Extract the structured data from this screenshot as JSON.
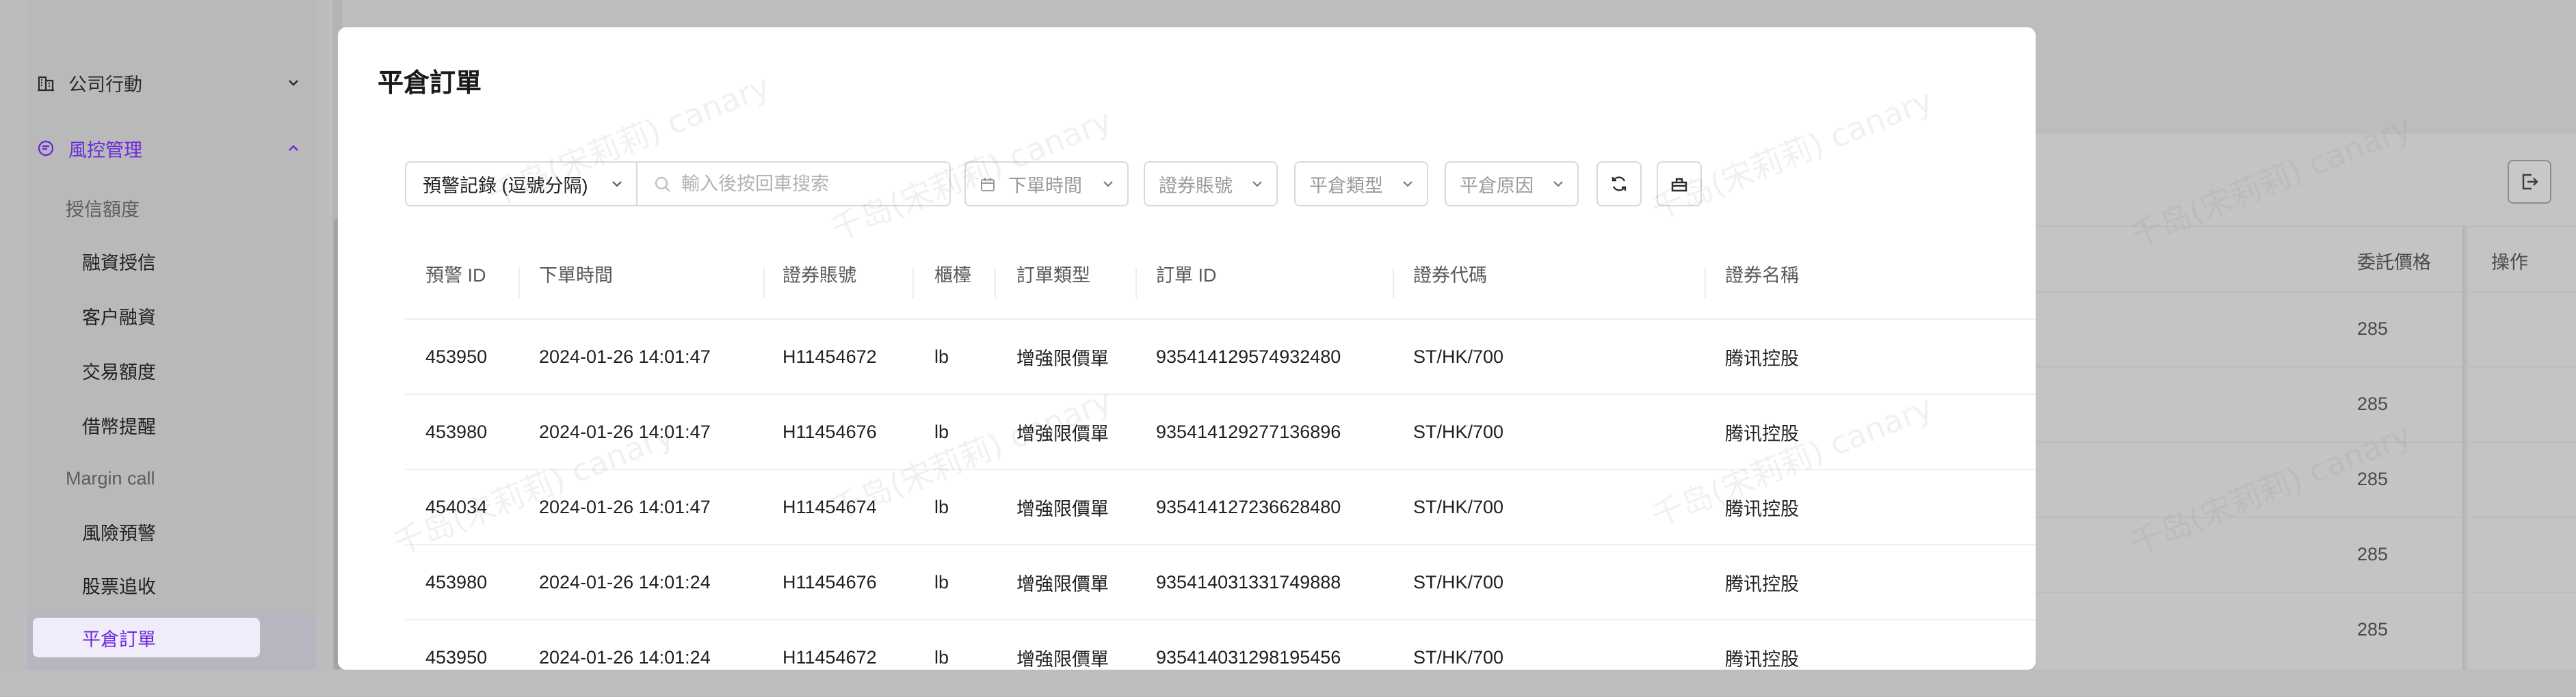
{
  "sidebar": {
    "groups": [
      {
        "label": "公司行動",
        "icon": "building-icon",
        "expanded": false
      },
      {
        "label": "風控管理",
        "icon": "risk-icon",
        "expanded": true
      }
    ],
    "subgroups": [
      "授信額度",
      "Margin call"
    ],
    "items": [
      "融資授信",
      "客户融資",
      "交易額度",
      "借幣提醒",
      "風險預警",
      "股票追收",
      "平倉訂單"
    ],
    "active_item": "平倉訂單",
    "accent": "#6a2bd9"
  },
  "modal": {
    "title": "平倉訂單"
  },
  "toolbar": {
    "search_type": "預警記錄 (逗號分隔)",
    "search_placeholder": "輸入後按回車搜索",
    "filters": [
      "下單時間",
      "證券賬號",
      "平倉類型",
      "平倉原因"
    ],
    "refresh_icon": "refresh-icon",
    "clear_icon": "clear-icon"
  },
  "table": {
    "columns": [
      "預警 ID",
      "下單時間",
      "證券賬號",
      "櫃檯",
      "訂單類型",
      "訂單 ID",
      "證券代碼",
      "證券名稱",
      "委託價格",
      "操作"
    ],
    "rows": [
      [
        "453950",
        "2024-01-26 14:01:47",
        "H11454672",
        "lb",
        "增強限價單",
        "935414129574932480",
        "ST/HK/700",
        "腾讯控股",
        "285"
      ],
      [
        "453980",
        "2024-01-26 14:01:47",
        "H11454676",
        "lb",
        "增強限價單",
        "935414129277136896",
        "ST/HK/700",
        "腾讯控股",
        "285"
      ],
      [
        "454034",
        "2024-01-26 14:01:47",
        "H11454674",
        "lb",
        "增強限價單",
        "935414127236628480",
        "ST/HK/700",
        "腾讯控股",
        "285"
      ],
      [
        "453980",
        "2024-01-26 14:01:24",
        "H11454676",
        "lb",
        "增強限價單",
        "935414031331749888",
        "ST/HK/700",
        "腾讯控股",
        "285"
      ],
      [
        "453950",
        "2024-01-26 14:01:24",
        "H11454672",
        "lb",
        "增強限價單",
        "935414031298195456",
        "ST/HK/700",
        "腾讯控股",
        "285"
      ]
    ]
  },
  "watermark": "千岛(宋莉莉) canary"
}
